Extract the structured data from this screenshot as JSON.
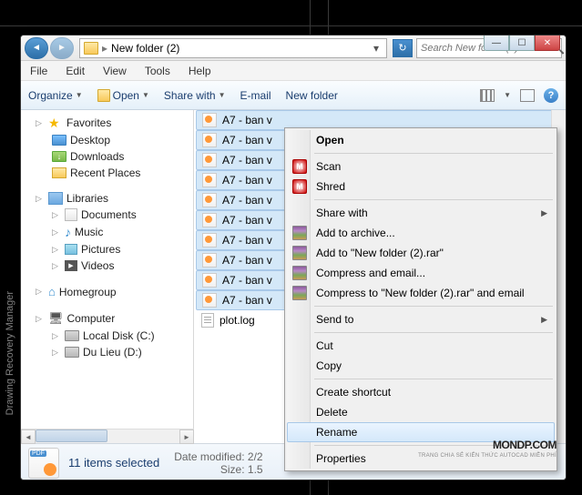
{
  "sidebar_label": "Drawing Recovery Manager",
  "address_bar": {
    "path": "New folder (2)",
    "dropdown": "▸"
  },
  "search": {
    "placeholder": "Search New folder (2)"
  },
  "window_controls": {
    "min": "—",
    "max": "☐",
    "close": "✕"
  },
  "menubar": {
    "file": "File",
    "edit": "Edit",
    "view": "View",
    "tools": "Tools",
    "help": "Help"
  },
  "toolbar": {
    "organize": "Organize",
    "open": "Open",
    "share": "Share with",
    "email": "E-mail",
    "new_folder": "New folder"
  },
  "tree": {
    "favorites": "Favorites",
    "desktop": "Desktop",
    "downloads": "Downloads",
    "recent": "Recent Places",
    "libraries": "Libraries",
    "documents": "Documents",
    "music": "Music",
    "pictures": "Pictures",
    "videos": "Videos",
    "homegroup": "Homegroup",
    "computer": "Computer",
    "local_disk": "Local Disk (C:)",
    "du_lieu": "Du Lieu (D:)"
  },
  "files": {
    "items": [
      "A7 - ban v",
      "A7 - ban v",
      "A7 - ban v",
      "A7 - ban v",
      "A7 - ban v",
      "A7 - ban v",
      "A7 - ban v",
      "A7 - ban v",
      "A7 - ban v",
      "A7 - ban v"
    ],
    "log": "plot.log"
  },
  "context_menu": {
    "open": "Open",
    "scan": "Scan",
    "shred": "Shred",
    "share_with": "Share with",
    "add_archive": "Add to archive...",
    "add_rar": "Add to \"New folder (2).rar\"",
    "compress_email": "Compress and email...",
    "compress_rar_email": "Compress to \"New folder (2).rar\" and email",
    "send_to": "Send to",
    "cut": "Cut",
    "copy": "Copy",
    "create_shortcut": "Create shortcut",
    "delete": "Delete",
    "rename": "Rename",
    "properties": "Properties"
  },
  "details": {
    "count": "11 items selected",
    "date_label": "Date modified:",
    "date_value": "2/2",
    "size_label": "Size:",
    "size_value": "1.5"
  },
  "watermark": {
    "main": "MONDP",
    "ext": ".COM",
    "sub": "TRANG CHIA SẺ KIẾN THỨC AUTOCAD MIỄN PHÍ"
  }
}
